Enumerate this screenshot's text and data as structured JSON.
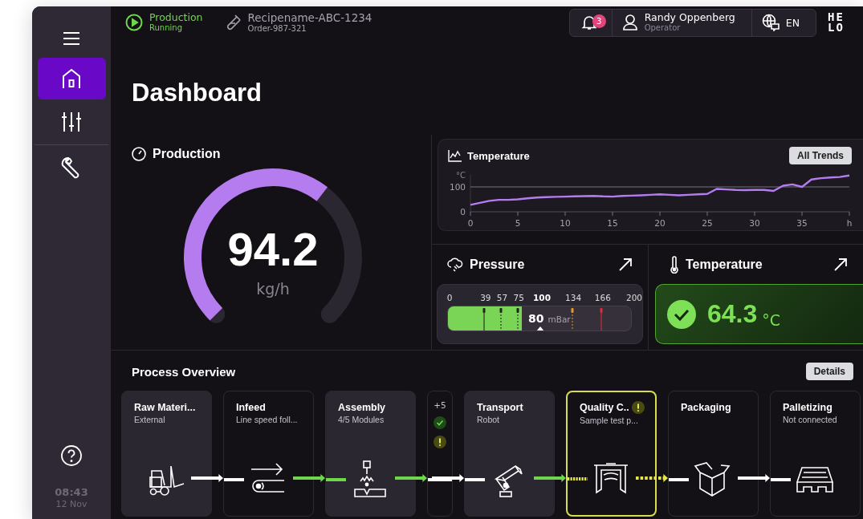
{
  "sidebar": {
    "items": [
      {
        "kind": "menu",
        "selected": false
      },
      {
        "kind": "home",
        "selected": true
      },
      {
        "kind": "sliders",
        "selected": false
      },
      {
        "kind": "wrench",
        "selected": false
      }
    ],
    "time": "08:43",
    "date": "12 Nov"
  },
  "top_bar": {
    "status": {
      "label": "Production",
      "state": "Running"
    },
    "recipe": {
      "name": "Recipename-ABC-1234",
      "order": "Order-987-321"
    },
    "notifications": {
      "count": "3"
    },
    "user": {
      "name": "Randy Oppenberg",
      "role": "Operator"
    },
    "language": "EN",
    "logo": [
      "HE",
      "LO"
    ]
  },
  "page_title": "Dashboard",
  "production": {
    "title": "Production",
    "value": "94.2",
    "unit": "kg/h"
  },
  "trend": {
    "title": "Temperature",
    "button": "All Trends",
    "chart_data": {
      "type": "line",
      "ylabel": "°C",
      "xlabel": "h",
      "x": [
        0,
        1,
        2,
        3,
        4,
        5,
        6,
        7,
        8,
        9,
        10,
        11,
        12,
        13,
        14,
        15,
        16,
        17,
        18,
        19,
        20,
        21,
        22,
        23,
        24,
        25,
        26,
        27,
        28,
        29,
        30,
        31,
        32,
        33,
        34,
        35,
        36,
        37,
        38,
        39,
        40
      ],
      "series": [
        {
          "color": "#b57cf0",
          "values": [
            28,
            36,
            44,
            48,
            48,
            50,
            54,
            57,
            59,
            60,
            61,
            62,
            63,
            64,
            62,
            61,
            64,
            65,
            66,
            68,
            70,
            68,
            66,
            68,
            70,
            72,
            92,
            90,
            88,
            87,
            88,
            88,
            84,
            105,
            110,
            100,
            130,
            135,
            138,
            140,
            146
          ]
        }
      ],
      "xlim": [
        0,
        40
      ],
      "ylim": [
        0,
        150
      ],
      "xticks": [
        0,
        5,
        10,
        15,
        20,
        25,
        30,
        35
      ],
      "yticks": [
        0,
        100
      ]
    }
  },
  "pressure": {
    "title": "Pressure",
    "level": 0.4,
    "reading": "80",
    "unit": "mBar",
    "ticks": [
      {
        "label": "0",
        "emphasized": false,
        "kind": "none"
      },
      {
        "label": "39",
        "emphasized": false,
        "kind": "solid"
      },
      {
        "label": "57",
        "emphasized": false,
        "kind": "dashed"
      },
      {
        "label": "75",
        "emphasized": false,
        "kind": "dashed"
      },
      {
        "label": "100",
        "emphasized": true,
        "kind": "none"
      },
      {
        "label": "134",
        "emphasized": false,
        "kind": "warning"
      },
      {
        "label": "166",
        "emphasized": false,
        "kind": "alarm"
      },
      {
        "label": "200",
        "emphasized": false,
        "kind": "none"
      }
    ]
  },
  "temperature": {
    "title": "Temperature",
    "value": "64.3",
    "unit": "°C",
    "kind": "ok"
  },
  "process": {
    "title": "Process Overview",
    "button": "Details",
    "steps": [
      {
        "kind": "forklift",
        "title": "Raw Materi...",
        "subtitle": "External",
        "filled": true,
        "alert": false,
        "flow_in": {
          "kind": "none"
        },
        "flow_out": {
          "kind": "normal"
        }
      },
      {
        "kind": "conveyor",
        "title": "Infeed",
        "subtitle": "Line speed foll...",
        "filled": false,
        "alert": false,
        "flow_in": {
          "kind": "normal"
        },
        "flow_out": {
          "kind": "ok"
        }
      },
      {
        "kind": "press",
        "title": "Assembly",
        "subtitle": "4/5 Modules",
        "filled": true,
        "alert": false,
        "flow_in": {
          "kind": "ok"
        },
        "flow_out": {
          "kind": "ok"
        }
      },
      {
        "kind": "summary",
        "count": "+5",
        "statuses": [
          {
            "kind": "ok"
          },
          {
            "kind": "warning"
          }
        ],
        "flow_in": {
          "kind": "normal"
        },
        "flow_out": {
          "kind": "normal"
        }
      },
      {
        "kind": "robot",
        "title": "Transport",
        "subtitle": "Robot",
        "filled": true,
        "alert": false,
        "flow_in": {
          "kind": "normal"
        },
        "flow_out": {
          "kind": "ok"
        }
      },
      {
        "kind": "gate",
        "title": "Quality C..",
        "subtitle": "Sample test p...",
        "filled": false,
        "alert": true,
        "flow_in": {
          "kind": "warning"
        },
        "flow_out": {
          "kind": "warning"
        }
      },
      {
        "kind": "box",
        "title": "Packaging",
        "filled": false,
        "alert": false,
        "flow_in": {
          "kind": "normal"
        },
        "flow_out": {
          "kind": "normal"
        }
      },
      {
        "kind": "pallet",
        "title": "Palletizing",
        "subtitle": "Not connected",
        "filled": false,
        "alert": false,
        "flow_in": {
          "kind": "normal"
        },
        "flow_out": {
          "kind": "none"
        }
      }
    ]
  }
}
